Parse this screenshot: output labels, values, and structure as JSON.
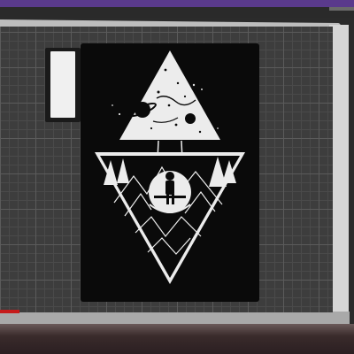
{
  "viewport": {
    "title_strip_color": "#5a3a8c",
    "bed_color": "#3d3d3d",
    "bed_frame_color": "#bdbdbd",
    "marker_color": "#c61b1b"
  },
  "objects": [
    {
      "name": "small-rectangle-part",
      "fill": "#f0f0f0",
      "border": "#1a1a1a"
    },
    {
      "name": "triangle-artwork-plate",
      "fill": "#ffffff",
      "background": "#0a0a0a"
    }
  ]
}
